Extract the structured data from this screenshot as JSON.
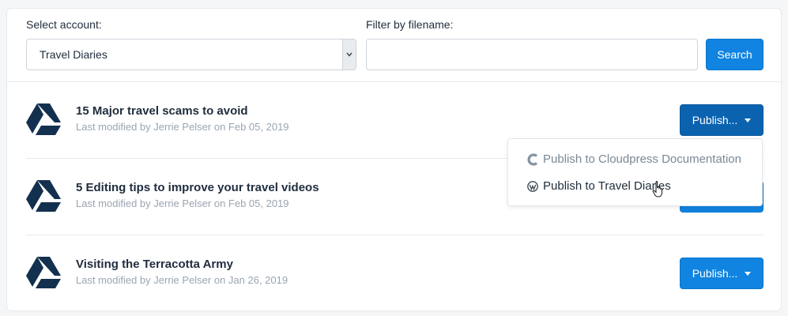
{
  "account": {
    "label": "Select account:",
    "selected": "Travel Diaries"
  },
  "filter": {
    "label": "Filter by filename:",
    "value": "",
    "placeholder": ""
  },
  "search_label": "Search",
  "publish_label": "Publish...",
  "documents": [
    {
      "title": "15 Major travel scams to avoid",
      "meta": "Last modified by Jerrie Pelser on Feb 05, 2019"
    },
    {
      "title": "5 Editing tips to improve your travel videos",
      "meta": "Last modified by Jerrie Pelser on Feb 05, 2019"
    },
    {
      "title": "Visiting the Terracotta Army",
      "meta": "Last modified by Jerrie Pelser on Jan 26, 2019"
    }
  ],
  "dropdown": {
    "items": [
      {
        "label": "Publish to Cloudpress Documentation",
        "icon": "cloudpress-icon"
      },
      {
        "label": "Publish to Travel Diaries",
        "icon": "wordpress-icon"
      }
    ]
  },
  "colors": {
    "accent": "#1084e0",
    "accent_active": "#0b63b0",
    "drive_icon": "#14304f",
    "muted_text": "#9aa5b1"
  }
}
